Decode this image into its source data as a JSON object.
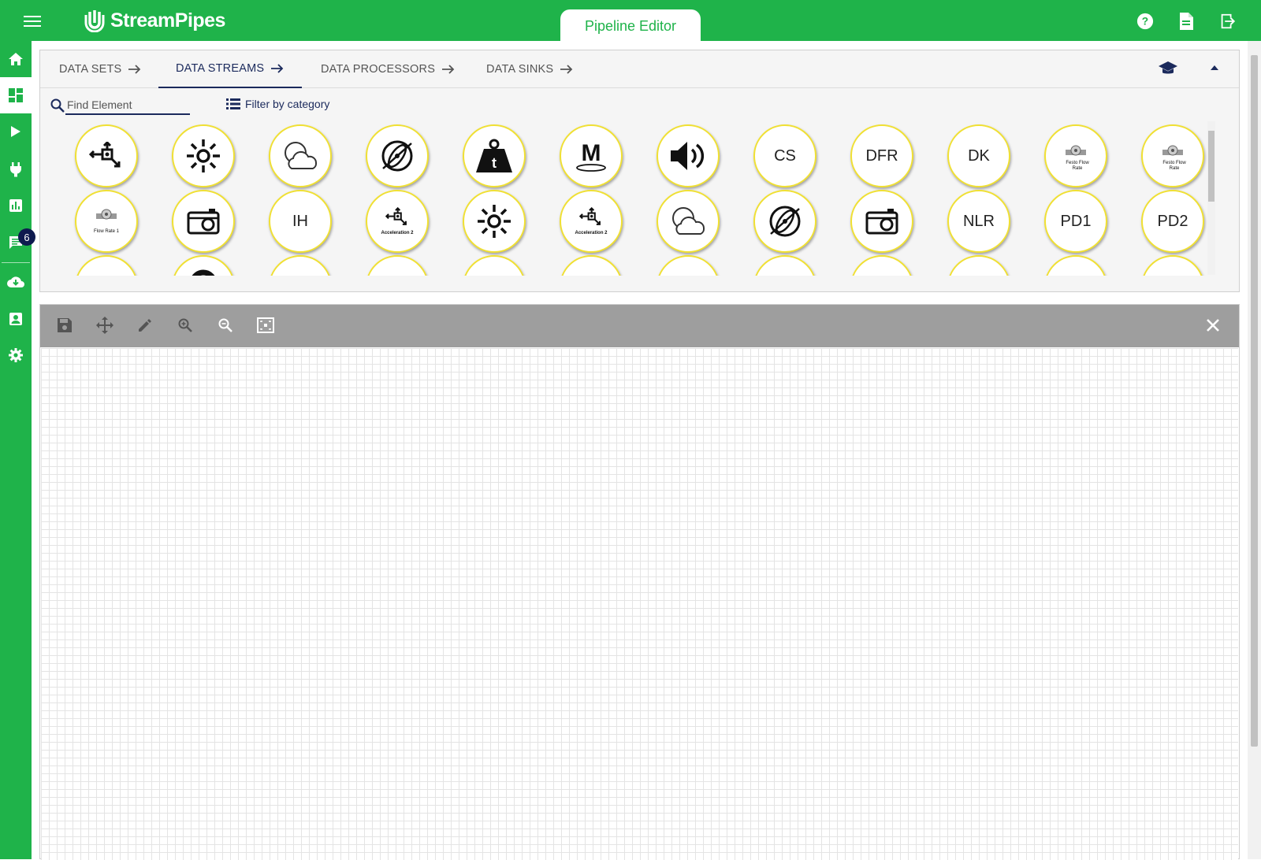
{
  "app": {
    "logo_text": "StreamPipes",
    "active_page": "Pipeline Editor",
    "brand_color": "#1fb34a",
    "accent_color": "#1b2a5c",
    "element_border_color": "#f0e033"
  },
  "top_icons": [
    {
      "name": "help-icon"
    },
    {
      "name": "documentation-icon"
    },
    {
      "name": "logout-icon"
    }
  ],
  "nav": {
    "items": [
      {
        "name": "home-icon"
      },
      {
        "name": "pipeline-editor-icon",
        "active": true
      },
      {
        "name": "pipelines-play-icon"
      },
      {
        "name": "connect-plug-icon"
      },
      {
        "name": "dashboard-chart-icon"
      },
      {
        "name": "notifications-icon"
      },
      {
        "name": "install-cloud-icon"
      },
      {
        "name": "profile-icon"
      },
      {
        "name": "settings-gear-icon"
      }
    ],
    "notification_count": "6"
  },
  "panel": {
    "tabs": [
      {
        "label": "DATA SETS"
      },
      {
        "label": "DATA STREAMS",
        "active": true
      },
      {
        "label": "DATA PROCESSORS"
      },
      {
        "label": "DATA SINKS"
      }
    ],
    "search_placeholder": "Find Element",
    "filter_label": "Filter by category",
    "elements_row1": [
      {
        "icon": "acceleration-icon"
      },
      {
        "icon": "brightness-icon"
      },
      {
        "icon": "weather-icon"
      },
      {
        "icon": "gyroscope-icon"
      },
      {
        "icon": "weight-icon"
      },
      {
        "icon": "magnetometer-icon"
      },
      {
        "icon": "speaker-icon"
      },
      {
        "label": "CS"
      },
      {
        "label": "DFR"
      },
      {
        "label": "DK"
      },
      {
        "icon": "flow-meter-icon",
        "sub": "Festo Flow Rate"
      },
      {
        "icon": "flow-meter-icon",
        "sub": "Festo Flow Rate"
      }
    ],
    "elements_row2": [
      {
        "icon": "flow-meter-icon",
        "sub": "Flow Rate 1"
      },
      {
        "icon": "camera-icon"
      },
      {
        "label": "IH"
      },
      {
        "icon": "acceleration-icon",
        "sub": "Acceleration 2"
      },
      {
        "icon": "brightness-icon"
      },
      {
        "icon": "acceleration-icon",
        "sub": "Acceleration 2"
      },
      {
        "icon": "weather-icon"
      },
      {
        "icon": "gyroscope-icon"
      },
      {
        "icon": "camera-icon"
      },
      {
        "label": "NLR"
      },
      {
        "label": "PD1"
      },
      {
        "label": "PD2"
      }
    ]
  },
  "editor": {
    "tools": [
      {
        "name": "save-pipeline-icon"
      },
      {
        "name": "pan-icon"
      },
      {
        "name": "edit-icon"
      },
      {
        "name": "zoom-in-icon"
      },
      {
        "name": "zoom-out-icon"
      },
      {
        "name": "fit-screen-icon"
      }
    ]
  }
}
